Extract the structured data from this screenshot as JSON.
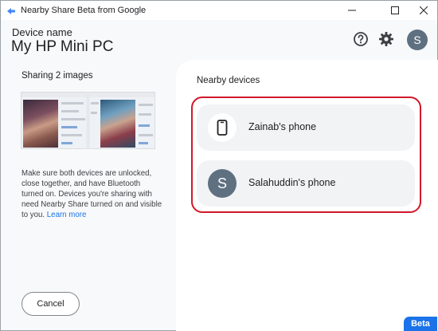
{
  "window": {
    "title": "Nearby Share Beta from Google",
    "minimize_icon": "minimize-icon",
    "maximize_icon": "maximize-icon",
    "close_icon": "close-icon"
  },
  "header": {
    "device_label": "Device name",
    "device_name": "My HP Mini PC",
    "help_icon": "help-icon",
    "settings_icon": "gear-icon",
    "avatar_letter": "S"
  },
  "left_panel": {
    "sharing_title": "Sharing 2 images",
    "info_text": "Make sure both devices are unlocked, close together, and have Bluetooth turned on. Devices you're sharing with need Nearby Share turned on and visible to you.",
    "learn_more": "Learn more",
    "cancel_label": "Cancel"
  },
  "right_panel": {
    "title": "Nearby devices",
    "devices": [
      {
        "name": "Zainab's phone",
        "icon": "phone-icon"
      },
      {
        "name": "Salahuddin's phone",
        "avatar_letter": "S"
      }
    ]
  },
  "badge": {
    "label": "Beta"
  },
  "colors": {
    "accent": "#1a73e8",
    "avatar": "#5f7081",
    "highlight": "#d0192a",
    "card": "#f1f3f4",
    "panel": "#f8f9fa"
  }
}
